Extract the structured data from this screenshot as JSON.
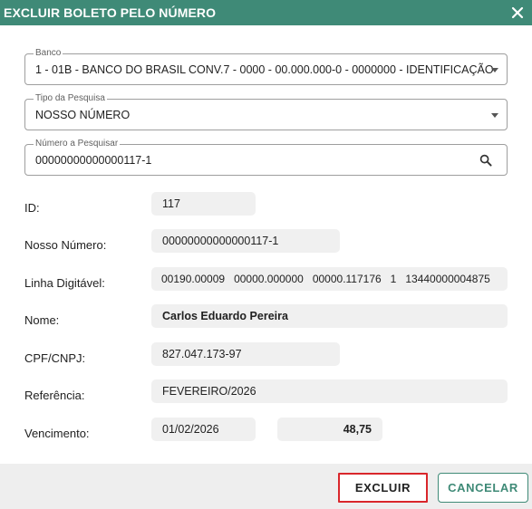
{
  "dialog": {
    "title": "EXCLUIR BOLETO PELO NÚMERO"
  },
  "fields": {
    "banco": {
      "label": "Banco",
      "value": "1 - 01B - BANCO DO BRASIL CONV.7 - 0000 - 00.000.000-0 - 0000000 - IDENTIFICAÇÃO"
    },
    "tipo_pesquisa": {
      "label": "Tipo da Pesquisa",
      "value": "NOSSO NÚMERO"
    },
    "numero_pesquisar": {
      "label": "Número a Pesquisar",
      "value": "00000000000000117-1"
    }
  },
  "details": {
    "id": {
      "label": "ID:",
      "value": "117"
    },
    "nosso_numero": {
      "label": "Nosso Número:",
      "value": "00000000000000117-1"
    },
    "linha_digitavel": {
      "label": "Linha Digitável:",
      "value": "00190.00009   00000.000000   00000.117176   1   13440000004875"
    },
    "nome": {
      "label": "Nome:",
      "value": "Carlos Eduardo Pereira"
    },
    "cpf_cnpj": {
      "label": "CPF/CNPJ:",
      "value": "827.047.173-97"
    },
    "referencia": {
      "label": "Referência:",
      "value": "FEVEREIRO/2026"
    },
    "vencimento": {
      "label": "Vencimento:",
      "date": "01/02/2026",
      "amount": "48,75"
    }
  },
  "footer": {
    "delete_label": "EXCLUIR",
    "cancel_label": "CANCELAR"
  },
  "colors": {
    "primary": "#3f8a77",
    "highlight_border": "#d9262b",
    "readonly_bg": "#f0f0f0",
    "footer_bg": "#eeeeee"
  },
  "icons": {
    "close": "close-icon",
    "dropdown": "chevron-down-icon",
    "search": "search-icon"
  }
}
